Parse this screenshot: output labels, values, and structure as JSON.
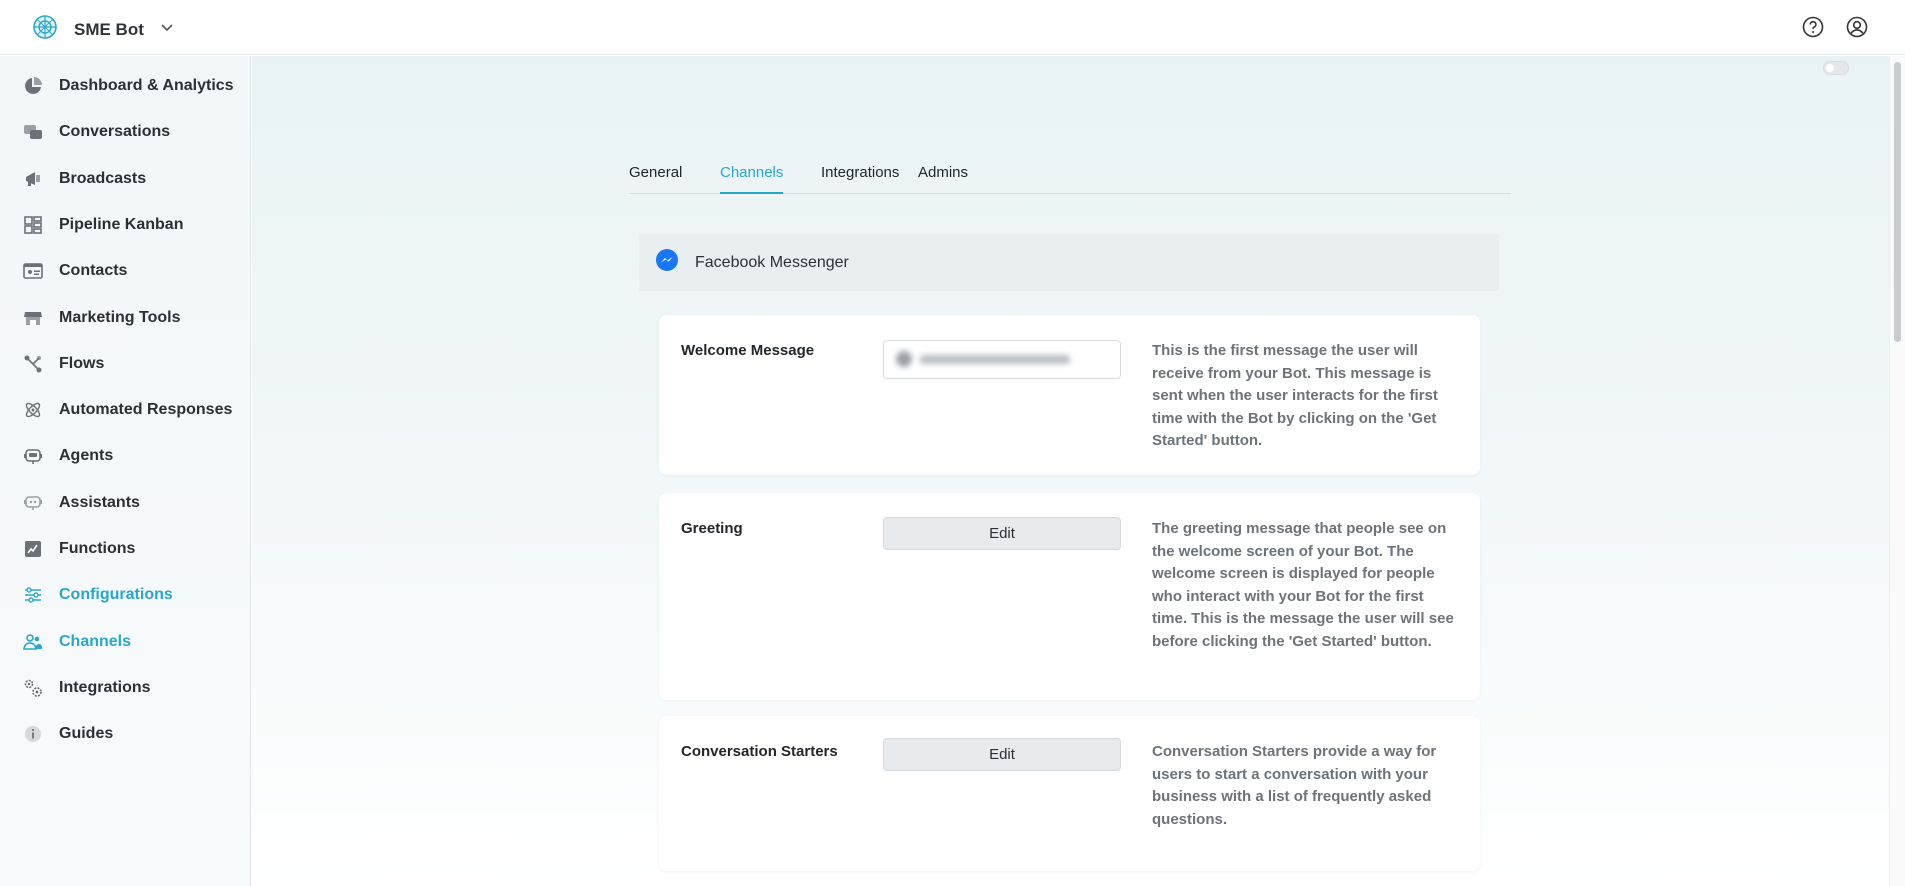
{
  "header": {
    "bot_name": "SME Bot"
  },
  "sidebar": {
    "items": [
      {
        "label": "Dashboard & Analytics",
        "icon": "pie-chart-icon"
      },
      {
        "label": "Conversations",
        "icon": "chat-bubbles-icon"
      },
      {
        "label": "Broadcasts",
        "icon": "megaphone-icon"
      },
      {
        "label": "Pipeline Kanban",
        "icon": "kanban-icon"
      },
      {
        "label": "Contacts",
        "icon": "contact-card-icon"
      },
      {
        "label": "Marketing Tools",
        "icon": "storefront-icon"
      },
      {
        "label": "Flows",
        "icon": "flow-icon"
      },
      {
        "label": "Automated Responses",
        "icon": "atom-icon"
      },
      {
        "label": "Agents",
        "icon": "agent-icon"
      },
      {
        "label": "Assistants",
        "icon": "assistant-icon"
      },
      {
        "label": "Functions",
        "icon": "function-icon"
      },
      {
        "label": "Configurations",
        "icon": "sliders-icon"
      },
      {
        "label": "Channels",
        "icon": "users-icon"
      },
      {
        "label": "Integrations",
        "icon": "gears-icon"
      },
      {
        "label": "Guides",
        "icon": "info-icon"
      }
    ],
    "active": [
      "Configurations",
      "Channels"
    ]
  },
  "tabs": [
    "General",
    "Channels",
    "Integrations",
    "Admins"
  ],
  "active_tab": "Channels",
  "channel": {
    "name": "Facebook Messenger",
    "icon": "messenger-icon"
  },
  "settings": [
    {
      "title": "Welcome Message",
      "control": "blurred-input",
      "description": "This is the first message the user will receive from your Bot. This message is sent when the user interacts for the first time with the Bot by clicking on the 'Get Started' button."
    },
    {
      "title": "Greeting",
      "control": "edit-button",
      "button_label": "Edit",
      "description": "The greeting message that people see on the welcome screen of your Bot. The welcome screen is displayed for people who interact with your Bot for the first time. This is the message the user will see before clicking the 'Get Started' button."
    },
    {
      "title": "Conversation Starters",
      "control": "edit-button",
      "button_label": "Edit",
      "description": "Conversation Starters provide a way for users to start a conversation with your business with a list of frequently asked questions."
    }
  ],
  "colors": {
    "accent": "#2aa7c7",
    "messenger": "#1877f2"
  }
}
